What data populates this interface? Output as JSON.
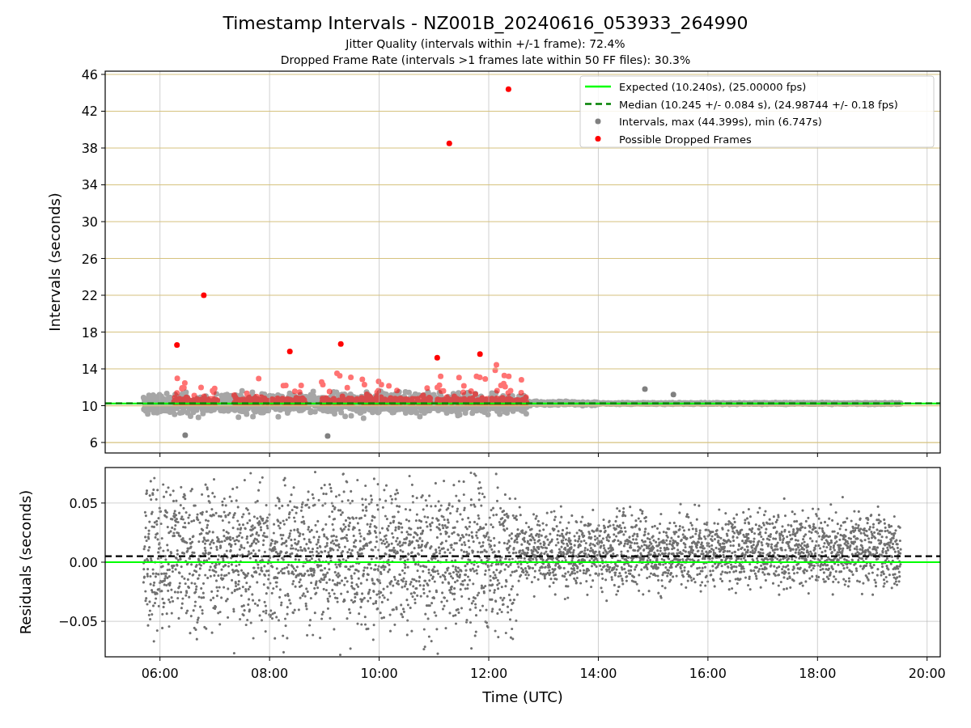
{
  "figure": {
    "title": "Timestamp Intervals - NZ001B_20240616_053933_264990",
    "subtitles": [
      "Jitter Quality (intervals within +/-1 frame): 72.4%",
      "Dropped Frame Rate (intervals >1 frames late within 50 FF files): 30.3%"
    ]
  },
  "intervals_panel": {
    "chart_data": {
      "type": "scatter",
      "ylabel": "Intervals (seconds)",
      "xlim": [
        5.0,
        20.24
      ],
      "ylim": [
        4.86,
        46.35
      ],
      "grid": true,
      "legend": true,
      "yticks": [
        {
          "value": 6,
          "label": "6"
        },
        {
          "value": 10,
          "label": "10"
        },
        {
          "value": 14,
          "label": "14"
        },
        {
          "value": 18,
          "label": "18"
        },
        {
          "value": 22,
          "label": "22"
        },
        {
          "value": 26,
          "label": "26"
        },
        {
          "value": 30,
          "label": "30"
        },
        {
          "value": 34,
          "label": "34"
        },
        {
          "value": 38,
          "label": "38"
        },
        {
          "value": 42,
          "label": "42"
        },
        {
          "value": 46,
          "label": "46"
        }
      ],
      "ref_lines": [
        {
          "axis": "y",
          "value": 10.24,
          "label": "Expected (10.240s), (25.00000 fps)",
          "color": "#00ff00",
          "line_style": "solid"
        },
        {
          "axis": "y",
          "value": 10.25,
          "label": "Median (10.245 +/- 0.084 s), (24.98744 +/- 0.18 fps)",
          "color": "#008000",
          "line_style": "dashed"
        }
      ],
      "series": [
        {
          "name": "Intervals, max (44.399s), min (6.747s)",
          "color": "#808080",
          "x": [
            6.46,
            9.06,
            14.85,
            15.37
          ],
          "values": [
            6.8,
            6.7,
            11.8,
            11.2
          ]
        },
        {
          "name": "Possible Dropped Frames",
          "color": "#ff0000",
          "x": [
            12.36,
            11.28,
            6.8,
            6.31,
            9.3,
            8.37,
            11.84,
            11.06
          ],
          "values": [
            44.4,
            38.5,
            22.0,
            16.6,
            16.7,
            15.9,
            15.6,
            15.2
          ]
        }
      ]
    }
  },
  "residuals_panel": {
    "chart_data": {
      "type": "scatter",
      "xlabel": "Time (UTC)",
      "ylabel": "Residuals (seconds)",
      "xlim": [
        5.0,
        20.24
      ],
      "ylim": [
        -0.08,
        0.08
      ],
      "grid": true,
      "xticks": [
        {
          "value": 6,
          "label": "06:00"
        },
        {
          "value": 8,
          "label": "08:00"
        },
        {
          "value": 10,
          "label": "10:00"
        },
        {
          "value": 12,
          "label": "12:00"
        },
        {
          "value": 14,
          "label": "14:00"
        },
        {
          "value": 16,
          "label": "16:00"
        },
        {
          "value": 18,
          "label": "18:00"
        },
        {
          "value": 20,
          "label": "20:00"
        }
      ],
      "yticks": [
        {
          "value": -0.05,
          "label": "−0.05"
        },
        {
          "value": 0,
          "label": "0.00"
        },
        {
          "value": 0.05,
          "label": "0.05"
        }
      ],
      "ref_lines": [
        {
          "axis": "y",
          "value": 0,
          "color": "#00ff00",
          "line_style": "solid"
        },
        {
          "axis": "y",
          "value": 0.005,
          "color": "#000000",
          "line_style": "dashed"
        }
      ]
    }
  }
}
